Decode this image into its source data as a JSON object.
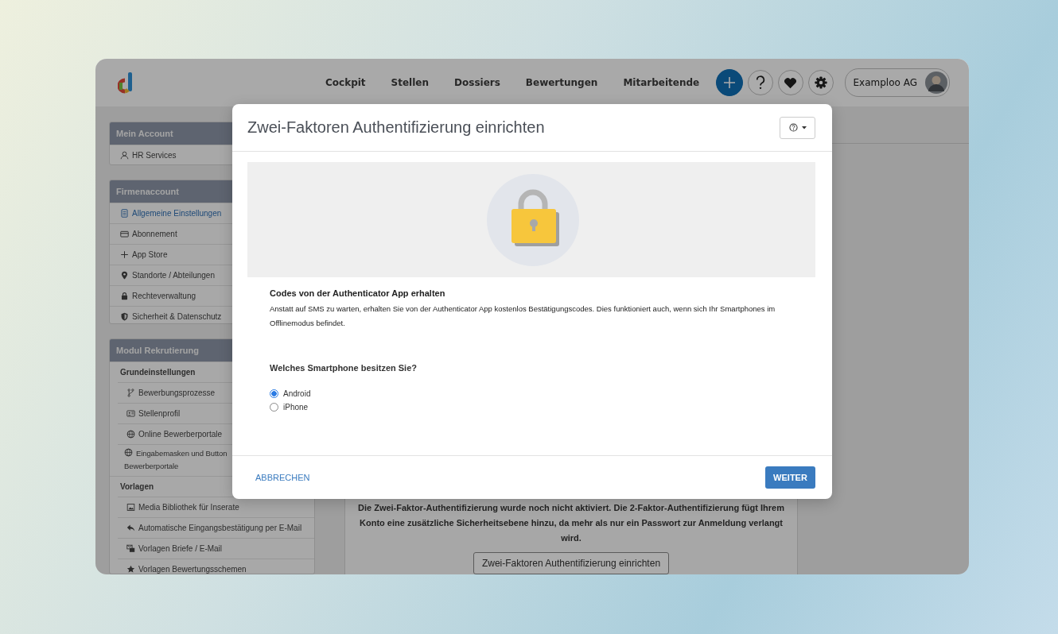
{
  "header": {
    "nav": [
      {
        "label": "Cockpit"
      },
      {
        "label": "Stellen"
      },
      {
        "label": "Dossiers"
      },
      {
        "label": "Bewertungen"
      },
      {
        "label": "Mitarbeitende"
      }
    ],
    "account": {
      "name": "Examploo AG"
    }
  },
  "sidebar": {
    "sections": [
      {
        "title": "Mein Account",
        "items": [
          {
            "kind": "link",
            "label": "HR Services",
            "selected": false
          }
        ]
      },
      {
        "title": "Firmenaccount",
        "items": [
          {
            "kind": "link",
            "label": "Allgemeine Einstellungen",
            "selected": true
          },
          {
            "kind": "link",
            "label": "Abonnement",
            "selected": false
          },
          {
            "kind": "link",
            "label": "App Store",
            "selected": false
          },
          {
            "kind": "link",
            "label": "Standorte / Abteilungen",
            "selected": false
          },
          {
            "kind": "link",
            "label": "Rechteverwaltung",
            "selected": false
          },
          {
            "kind": "link",
            "label": "Sicherheit & Datenschutz",
            "selected": false
          }
        ]
      },
      {
        "title": "Modul Rekrutierung",
        "items": [
          {
            "kind": "group",
            "label": "Grundeinstellungen"
          },
          {
            "kind": "sublink",
            "label": "Bewerbungsprozesse",
            "selected": false
          },
          {
            "kind": "sublink",
            "label": "Stellenprofil",
            "selected": false
          },
          {
            "kind": "sublink",
            "label": "Online Bewerberportale",
            "selected": false
          },
          {
            "kind": "sublink",
            "lines": [
              "Eingabemasken und Button",
              "Bewerberportale"
            ],
            "selected": false
          },
          {
            "kind": "group",
            "label": "Vorlagen"
          },
          {
            "kind": "sublink",
            "label": "Media Bibliothek für Inserate",
            "selected": false
          },
          {
            "kind": "sublink",
            "label": "Automatische Eingangsbestätigung per E-Mail",
            "selected": false
          },
          {
            "kind": "sublink",
            "label": "Vorlagen Briefe / E-Mail",
            "selected": false
          },
          {
            "kind": "sublink",
            "label": "Vorlagen Bewertungsschemen",
            "selected": false
          }
        ]
      }
    ]
  },
  "content": {
    "notice": "Die Zwei-Faktor-Authentifizierung wurde noch nicht aktiviert. Die 2-Faktor-Authentifizierung fügt Ihrem Konto eine zusätzliche Sicherheitsebene hinzu, da mehr als nur ein Passwort zur Anmeldung verlangt wird.",
    "button": "Zwei-Faktoren Authentifizierung einrichten"
  },
  "modal": {
    "title": "Zwei-Faktoren Authentifizierung einrichten",
    "heading": "Codes von der Authenticator App erhalten",
    "text": "Anstatt auf SMS zu warten, erhalten Sie von der Authenticator App kostenlos Bestätigungscodes. Dies funktioniert auch, wenn sich Ihr Smartphones im Offlinemodus befindet.",
    "question": "Welches Smartphone besitzen Sie?",
    "options": [
      {
        "label": "Android",
        "selected": true
      },
      {
        "label": "iPhone",
        "selected": false
      }
    ],
    "cancel": "ABBRECHEN",
    "next": "WEITER"
  }
}
